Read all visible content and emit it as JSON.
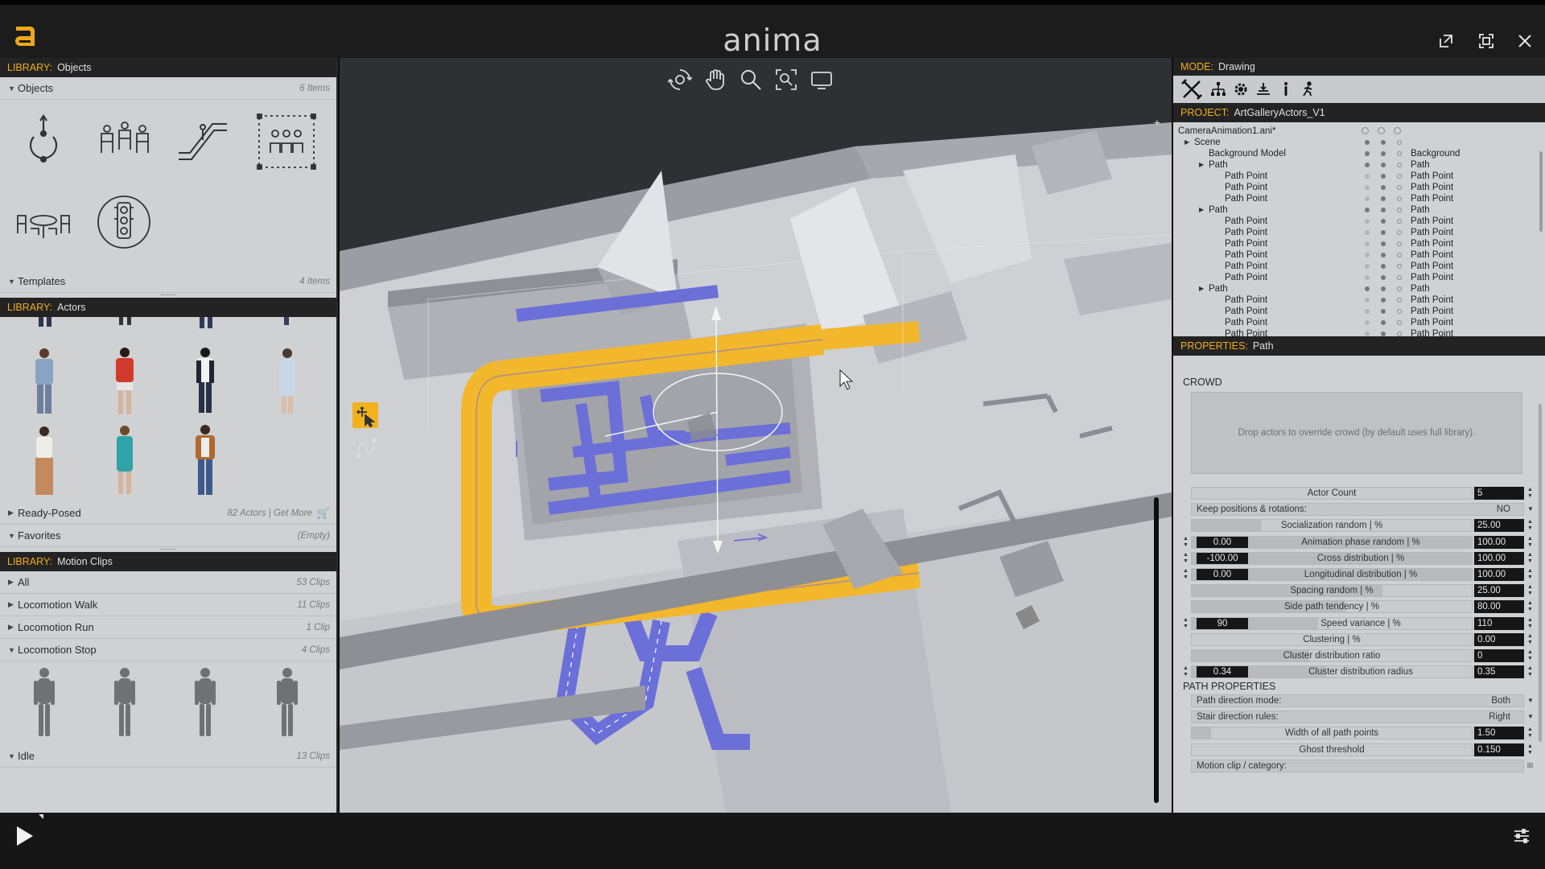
{
  "app": {
    "title": "anima"
  },
  "left": {
    "objects_library": {
      "label": "LIBRARY:",
      "value": "Objects"
    },
    "objects_section": {
      "name": "Objects",
      "count": "6 Items"
    },
    "templates_section": {
      "name": "Templates",
      "count": "4 Items"
    },
    "actors_library": {
      "label": "LIBRARY:",
      "value": "Actors"
    },
    "ready_posed": {
      "name": "Ready-Posed",
      "count": "82 Actors | Get More"
    },
    "favorites": {
      "name": "Favorites",
      "count": "(Empty)"
    },
    "motion_library": {
      "label": "LIBRARY:",
      "value": "Motion Clips"
    },
    "clips": [
      {
        "name": "All",
        "count": "53 Clips",
        "open": false
      },
      {
        "name": "Locomotion Walk",
        "count": "11 Clips",
        "open": false
      },
      {
        "name": "Locomotion Run",
        "count": "1 Clip",
        "open": false
      },
      {
        "name": "Locomotion Stop",
        "count": "4 Clips",
        "open": true
      }
    ],
    "idle": {
      "name": "Idle",
      "count": "13 Clips"
    }
  },
  "right": {
    "mode": {
      "label": "MODE:",
      "value": "Drawing"
    },
    "project": {
      "label": "PROJECT:",
      "value": "ArtGalleryActors_V1"
    },
    "tree": [
      {
        "name": "CameraAnimation1.ani*",
        "indent": 0,
        "tri": false,
        "val": "",
        "head": true
      },
      {
        "name": "Scene",
        "indent": 1,
        "tri": true,
        "val": ""
      },
      {
        "name": "Background Model",
        "indent": 2,
        "tri": false,
        "val": "Background"
      },
      {
        "name": "Path",
        "indent": 2,
        "tri": true,
        "val": "Path"
      },
      {
        "name": "Path Point",
        "indent": 3,
        "tri": false,
        "val": "Path Point"
      },
      {
        "name": "Path Point",
        "indent": 3,
        "tri": false,
        "val": "Path Point"
      },
      {
        "name": "Path Point",
        "indent": 3,
        "tri": false,
        "val": "Path Point"
      },
      {
        "name": "Path",
        "indent": 2,
        "tri": true,
        "val": "Path"
      },
      {
        "name": "Path Point",
        "indent": 3,
        "tri": false,
        "val": "Path Point"
      },
      {
        "name": "Path Point",
        "indent": 3,
        "tri": false,
        "val": "Path Point"
      },
      {
        "name": "Path Point",
        "indent": 3,
        "tri": false,
        "val": "Path Point"
      },
      {
        "name": "Path Point",
        "indent": 3,
        "tri": false,
        "val": "Path Point"
      },
      {
        "name": "Path Point",
        "indent": 3,
        "tri": false,
        "val": "Path Point"
      },
      {
        "name": "Path Point",
        "indent": 3,
        "tri": false,
        "val": "Path Point"
      },
      {
        "name": "Path",
        "indent": 2,
        "tri": true,
        "val": "Path"
      },
      {
        "name": "Path Point",
        "indent": 3,
        "tri": false,
        "val": "Path Point"
      },
      {
        "name": "Path Point",
        "indent": 3,
        "tri": false,
        "val": "Path Point"
      },
      {
        "name": "Path Point",
        "indent": 3,
        "tri": false,
        "val": "Path Point"
      },
      {
        "name": "Path Point",
        "indent": 3,
        "tri": false,
        "val": "Path Point"
      }
    ],
    "properties": {
      "label": "PROPERTIES:",
      "value": "Path"
    },
    "crowd": {
      "heading": "CROWD",
      "dropzone": "Drop actors to override crowd (by default uses full library).",
      "rows": [
        {
          "kind": "slider",
          "label": "Actor Count",
          "max": "5",
          "fill": 0.0
        },
        {
          "kind": "option",
          "label": "Keep positions & rotations:",
          "value": "NO"
        },
        {
          "kind": "slider",
          "label": "Socialization random | %",
          "max": "25.00",
          "fill": 0.25
        },
        {
          "kind": "range",
          "label": "Animation phase random | %",
          "min": "0.00",
          "max": "100.00",
          "fill": 1.0
        },
        {
          "kind": "range",
          "label": "Cross distribution | %",
          "min": "-100.00",
          "max": "100.00",
          "fill": 1.0
        },
        {
          "kind": "range",
          "label": "Longitudinal distribution | %",
          "min": "0.00",
          "max": "100.00",
          "fill": 1.0
        },
        {
          "kind": "slider",
          "label": "Spacing random | %",
          "max": "25.00",
          "fill": 0.68
        },
        {
          "kind": "slider",
          "label": "Side path tendency | %",
          "max": "80.00",
          "fill": 0.55
        },
        {
          "kind": "range",
          "label": "Speed variance | %",
          "min": "90",
          "max": "110",
          "fill": 0.45
        },
        {
          "kind": "slider",
          "label": "Clustering | %",
          "max": "0.00",
          "fill": 0.0
        },
        {
          "kind": "slider",
          "label": "Cluster distribution ratio",
          "max": "0",
          "fill": 0.42
        },
        {
          "kind": "range",
          "label": "Cluster distribution radius",
          "min": "0.34",
          "max": "0.35",
          "fill": 0.48
        }
      ]
    },
    "path_props": {
      "heading": "PATH PROPERTIES",
      "rows": [
        {
          "kind": "option",
          "label": "Path direction mode:",
          "value": "Both"
        },
        {
          "kind": "option",
          "label": "Stair direction rules:",
          "value": "Right"
        },
        {
          "kind": "slider",
          "label": "Width of all path points",
          "max": "1.50",
          "fill": 0.07
        },
        {
          "kind": "slider",
          "label": "Ghost threshold",
          "max": "0.150",
          "fill": 0.0
        },
        {
          "kind": "option",
          "label": "Motion clip / category:",
          "value": ""
        }
      ]
    }
  },
  "colors": {
    "accent": "#f2ae1c",
    "path_yellow": "#f2b72b",
    "path_blue": "#6b6fd8",
    "floor": "#cdced2"
  }
}
